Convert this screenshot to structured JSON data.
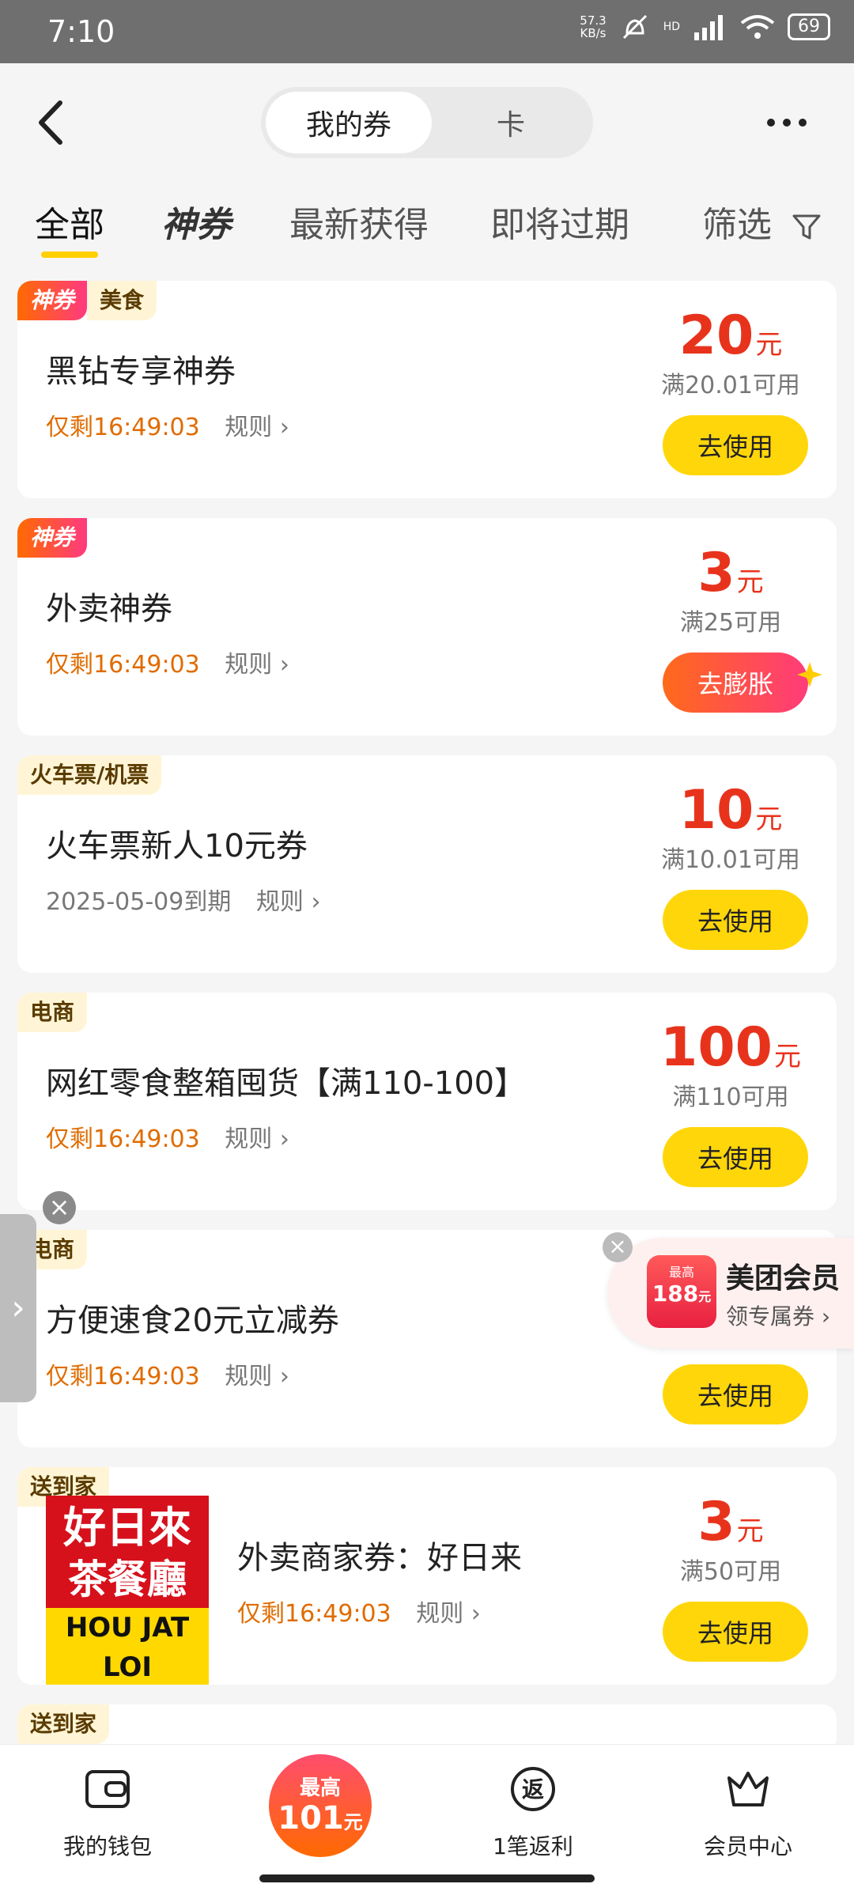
{
  "status_bar": {
    "time": "7:10",
    "speed_top": "57.3",
    "speed_bottom": "KB/s",
    "net": "HD",
    "battery": "69"
  },
  "header": {
    "seg_active": "我的券",
    "seg_other": "卡"
  },
  "tabs": {
    "all": "全部",
    "shen": "神券",
    "newest": "最新获得",
    "expiring": "即将过期",
    "filter": "筛选"
  },
  "cards": [
    {
      "tag_special": "神券",
      "tag_category": "美食",
      "title": "黑钻专享神券",
      "expiry": "仅剩16:49:03",
      "rules": "规则 ›",
      "value": "20",
      "unit": "元",
      "condition": "满20.01可用",
      "button": "去使用"
    },
    {
      "tag_special": "神券",
      "title": "外卖神券",
      "expiry": "仅剩16:49:03",
      "rules": "规则 ›",
      "value": "3",
      "unit": "元",
      "condition": "满25可用",
      "button": "去膨胀"
    },
    {
      "tag_category": "火车票/机票",
      "title": "火车票新人10元券",
      "expiry": "2025-05-09到期",
      "rules": "规则 ›",
      "value": "10",
      "unit": "元",
      "condition": "满10.01可用",
      "button": "去使用"
    },
    {
      "tag_category": "电商",
      "title": "网红零食整箱囤货【满110-100】",
      "expiry": "仅剩16:49:03",
      "rules": "规则 ›",
      "value": "100",
      "unit": "元",
      "condition": "满110可用",
      "button": "去使用"
    },
    {
      "tag_category": "电商",
      "title": "方便速食20元立减券",
      "expiry": "仅剩16:49:03",
      "rules": "规则 ›",
      "button": "去使用"
    },
    {
      "tag_category": "送到家",
      "title": "外卖商家券：好日来",
      "expiry": "仅剩16:49:03",
      "rules": "规则 ›",
      "value": "3",
      "unit": "元",
      "condition": "满50可用",
      "button": "去使用",
      "logo": {
        "line1": "好日來",
        "line2": "茶餐廳",
        "line3": "HOU JAT LOI"
      }
    },
    {
      "tag_category": "送到家"
    }
  ],
  "promo": {
    "badge_small": "最高",
    "badge_value": "188",
    "badge_unit": "元",
    "title": "美团会员",
    "subtitle": "领专属券 ›"
  },
  "bottom_nav": {
    "wallet": "我的钱包",
    "center_top": "最高",
    "center_value": "101",
    "center_unit": "元",
    "rebate": "1笔返利",
    "member": "会员中心"
  }
}
